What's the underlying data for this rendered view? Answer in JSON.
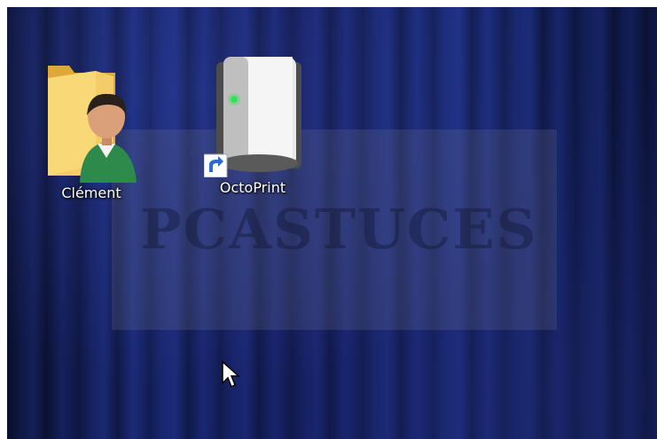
{
  "desktop": {
    "icons": [
      {
        "label": "Clément",
        "icon": "user-folder-icon"
      },
      {
        "label": "OctoPrint",
        "icon": "server-shortcut-icon"
      }
    ],
    "watermark": "PCASTUCES",
    "cursor": "arrow-cursor-icon"
  },
  "colors": {
    "wallpaper": "#1a2a78",
    "folder": "#f2c45c",
    "label_text": "#ffffff"
  }
}
